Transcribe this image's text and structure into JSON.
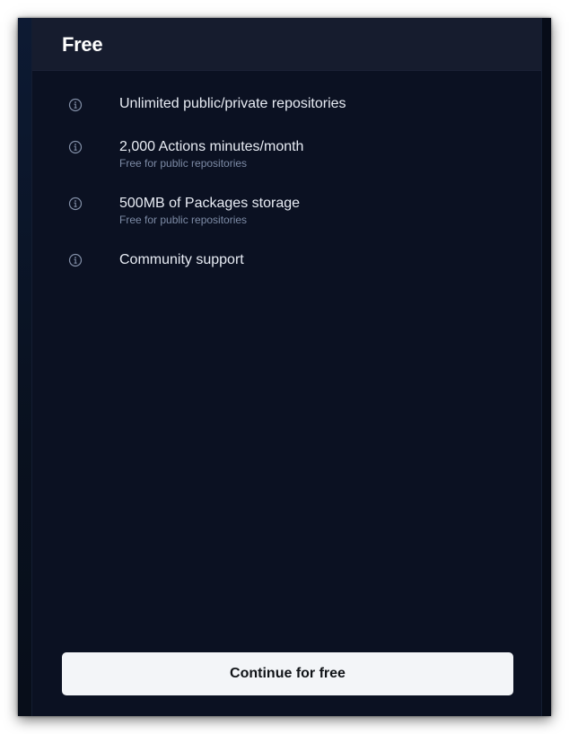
{
  "plan": {
    "title": "Free",
    "features": [
      {
        "icon": "info-icon",
        "title": "Unlimited public/private repositories",
        "subtitle": ""
      },
      {
        "icon": "info-icon",
        "title": "2,000 Actions minutes/month",
        "subtitle": "Free for public repositories"
      },
      {
        "icon": "info-icon",
        "title": "500MB of Packages storage",
        "subtitle": "Free for public repositories"
      },
      {
        "icon": "info-icon",
        "title": "Community support",
        "subtitle": ""
      }
    ],
    "cta_label": "Continue for free"
  },
  "colors": {
    "background": "#0b1122",
    "header": "#161c2e",
    "title": "#ffffff",
    "feature_text": "#e8ecf4",
    "subtext": "#7d8ba6",
    "button_bg": "#f3f5f8",
    "button_text": "#111418"
  }
}
